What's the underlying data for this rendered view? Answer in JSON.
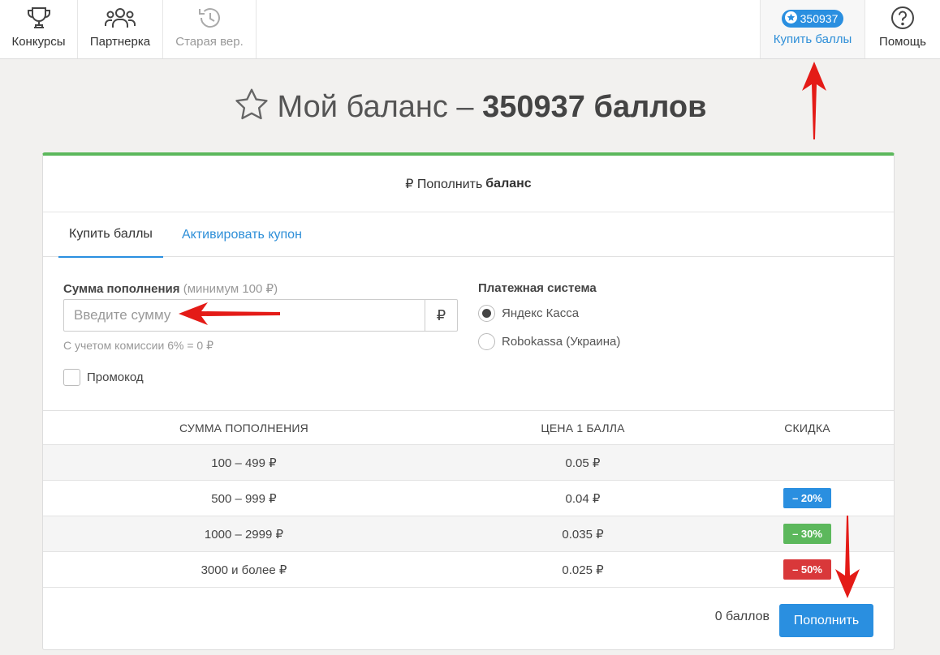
{
  "nav": {
    "contests_label": "Конкурсы",
    "partner_label": "Партнерка",
    "old_version_label": "Старая вер.",
    "balance_badge": "350937",
    "buy_points_label": "Купить баллы",
    "help_label": "Помощь"
  },
  "page": {
    "title_prefix": "Мой баланс –",
    "title_value": "350937 баллов"
  },
  "card": {
    "header_prefix": "₽ Пополнить",
    "header_bold": "баланс",
    "tabs": [
      {
        "label": "Купить баллы",
        "active": true
      },
      {
        "label": "Активировать купон",
        "active": false
      }
    ],
    "sum_label": "Сумма пополнения",
    "sum_hint": "(минимум 100 ₽)",
    "sum_placeholder": "Введите сумму",
    "currency_symbol": "₽",
    "commission_text": "С учетом комиссии 6% = 0 ₽",
    "promo_label": "Промокод",
    "payment_label": "Платежная система",
    "payment_options": [
      {
        "label": "Яндекс Касса",
        "selected": true
      },
      {
        "label": "Robokassa (Украина)",
        "selected": false
      }
    ]
  },
  "pricing": {
    "headers": [
      "СУММА ПОПОЛНЕНИЯ",
      "ЦЕНА 1 БАЛЛА",
      "СКИДКА"
    ],
    "rows": [
      {
        "range": "100 – 499 ₽",
        "price": "0.05 ₽",
        "discount": ""
      },
      {
        "range": "500 – 999 ₽",
        "price": "0.04 ₽",
        "discount": "– 20%"
      },
      {
        "range": "1000 – 2999 ₽",
        "price": "0.035 ₽",
        "discount": "– 30%"
      },
      {
        "range": "3000 и более ₽",
        "price": "0.025 ₽",
        "discount": "– 50%"
      }
    ],
    "discount_colors": [
      "#2a8fe0",
      "#5cb85c",
      "#d9383a"
    ]
  },
  "footer": {
    "total_points": "0 баллов",
    "submit_label": "Пополнить"
  },
  "colors": {
    "accent": "#2a8fe0",
    "success": "#5cb85c",
    "annotation_arrow": "#e41b17"
  }
}
